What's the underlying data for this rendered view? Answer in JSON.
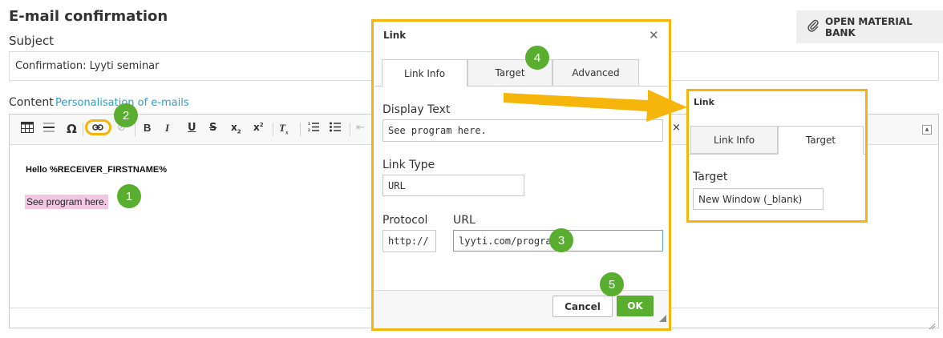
{
  "page": {
    "title": "E-mail confirmation",
    "subject_label": "Subject",
    "subject_value": "Confirmation: Lyyti seminar",
    "content_label": "Content",
    "content_link": "Personalisation of e-mails",
    "material_bank_label": "OPEN MATERIAL BANK"
  },
  "toolbar": {
    "items": [
      "table-icon",
      "horizontal-rule-icon",
      "special-char-icon",
      "link-icon",
      "unlink-icon",
      "bold-icon",
      "italic-icon",
      "underline-icon",
      "strikethrough-icon",
      "subscript-icon",
      "superscript-icon",
      "remove-format-icon",
      "numbered-list-icon",
      "bulleted-list-icon",
      "outdent-icon"
    ]
  },
  "editor": {
    "greeting": "Hello %RECEIVER_FIRSTNAME%",
    "selected_text": "See program here."
  },
  "badges": [
    "1",
    "2",
    "3",
    "4",
    "5"
  ],
  "dialog": {
    "title": "Link",
    "close": "✕",
    "tabs": [
      "Link Info",
      "Target",
      "Advanced"
    ],
    "active_tab": "Link Info",
    "display_text_label": "Display Text",
    "display_text_value": "See program here.",
    "link_type_label": "Link Type",
    "link_type_value": "URL",
    "protocol_label": "Protocol",
    "protocol_value": "http://",
    "url_label": "URL",
    "url_value": "lyyti.com/program",
    "cancel_label": "Cancel",
    "ok_label": "OK"
  },
  "inset": {
    "title": "Link",
    "tabs": [
      "Link Info",
      "Target"
    ],
    "active_tab": "Target",
    "target_label": "Target",
    "target_value": "New Window (_blank)"
  },
  "colors": {
    "highlight_frame": "#f5b50a",
    "badge_green": "#59ad2f",
    "link_blue": "#2aa1c9",
    "selection_pink": "#f2c7e4"
  }
}
